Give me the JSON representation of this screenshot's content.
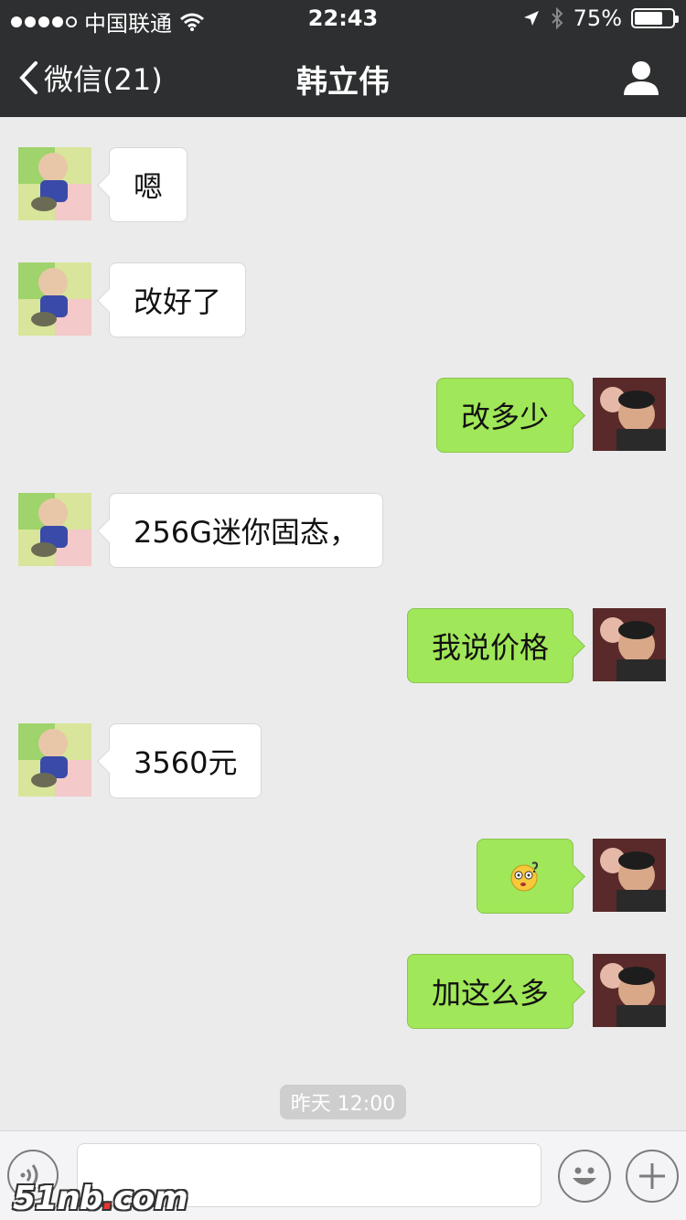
{
  "status_bar": {
    "carrier": "中国联通",
    "time": "22:43",
    "battery": "75%",
    "battery_level": 0.75
  },
  "nav": {
    "back_label": "微信(21)",
    "title": "韩立伟"
  },
  "messages": [
    {
      "side": "in",
      "text": "嗯"
    },
    {
      "side": "in",
      "text": "改好了"
    },
    {
      "side": "out",
      "text": "改多少"
    },
    {
      "side": "in",
      "text": "256G迷你固态，"
    },
    {
      "side": "out",
      "text": "我说价格"
    },
    {
      "side": "in",
      "text": "3560元"
    },
    {
      "side": "out",
      "text": "",
      "emoji": "confused-face-emoji"
    },
    {
      "side": "out",
      "text": "加这么多"
    }
  ],
  "timestamp": "昨天 12:00",
  "input": {
    "value": "",
    "placeholder": ""
  },
  "watermark": {
    "brand": "51nb",
    "dot": ".",
    "tld": "com"
  }
}
